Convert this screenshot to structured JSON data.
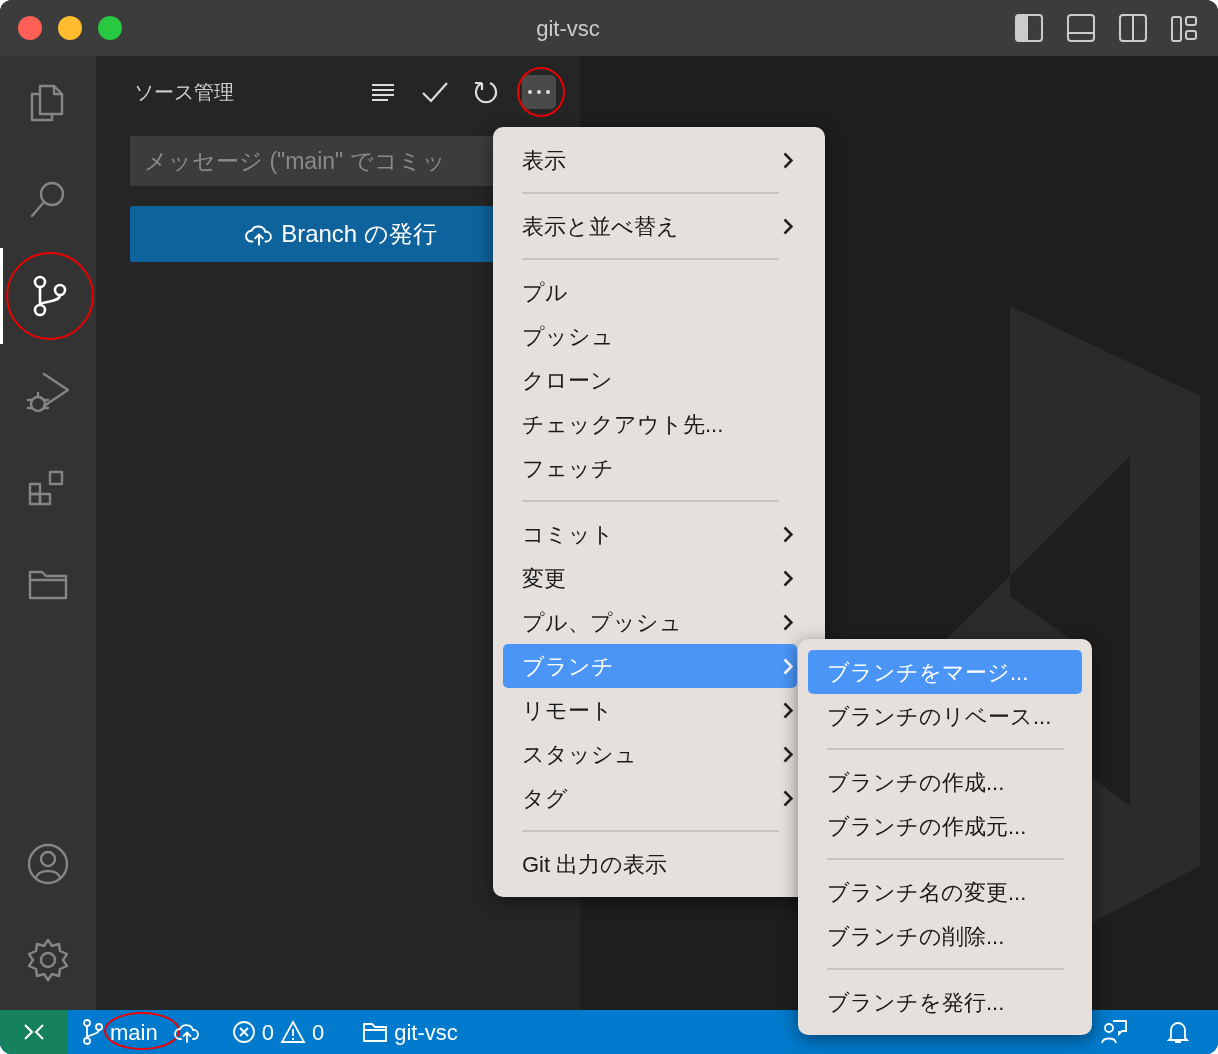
{
  "window": {
    "title": "git-vsc"
  },
  "activity_bar": [
    {
      "kind": "files",
      "selected": false,
      "highlighted": false
    },
    {
      "kind": "search",
      "selected": false,
      "highlighted": false
    },
    {
      "kind": "source-control",
      "selected": true,
      "highlighted": true
    },
    {
      "kind": "debug",
      "selected": false,
      "highlighted": false
    },
    {
      "kind": "extensions",
      "selected": false,
      "highlighted": false
    },
    {
      "kind": "folder",
      "selected": false,
      "highlighted": false
    }
  ],
  "activity_bar_bottom": [
    {
      "kind": "account"
    },
    {
      "kind": "settings"
    }
  ],
  "sidebar": {
    "title": "ソース管理",
    "more_highlighted": true,
    "message": {
      "placeholder": "メッセージ (\"main\" でコミッ"
    },
    "publish_button": "Branch の発行"
  },
  "menu": {
    "groups": [
      [
        {
          "label": "表示",
          "submenu": true,
          "selected": false
        }
      ],
      [
        {
          "label": "表示と並べ替え",
          "submenu": true,
          "selected": false
        }
      ],
      [
        {
          "label": "プル",
          "submenu": false,
          "selected": false
        },
        {
          "label": "プッシュ",
          "submenu": false,
          "selected": false
        },
        {
          "label": "クローン",
          "submenu": false,
          "selected": false
        },
        {
          "label": "チェックアウト先...",
          "submenu": false,
          "selected": false
        },
        {
          "label": "フェッチ",
          "submenu": false,
          "selected": false
        }
      ],
      [
        {
          "label": "コミット",
          "submenu": true,
          "selected": false
        },
        {
          "label": "変更",
          "submenu": true,
          "selected": false
        },
        {
          "label": "プル、プッシュ",
          "submenu": true,
          "selected": false
        },
        {
          "label": "ブランチ",
          "submenu": true,
          "selected": true
        },
        {
          "label": "リモート",
          "submenu": true,
          "selected": false
        },
        {
          "label": "スタッシュ",
          "submenu": true,
          "selected": false
        },
        {
          "label": "タグ",
          "submenu": true,
          "selected": false
        }
      ],
      [
        {
          "label": "Git 出力の表示",
          "submenu": false,
          "selected": false
        }
      ]
    ]
  },
  "submenu": {
    "groups": [
      [
        {
          "label": "ブランチをマージ...",
          "selected": true
        },
        {
          "label": "ブランチのリベース...",
          "selected": false
        }
      ],
      [
        {
          "label": "ブランチの作成...",
          "selected": false
        },
        {
          "label": "ブランチの作成元...",
          "selected": false
        }
      ],
      [
        {
          "label": "ブランチ名の変更...",
          "selected": false
        },
        {
          "label": "ブランチの削除...",
          "selected": false
        }
      ],
      [
        {
          "label": "ブランチを発行...",
          "selected": false
        }
      ]
    ]
  },
  "status_bar": {
    "branch": "main",
    "branch_highlighted": true,
    "errors": "0",
    "warnings": "0",
    "folder": "git-vsc"
  }
}
